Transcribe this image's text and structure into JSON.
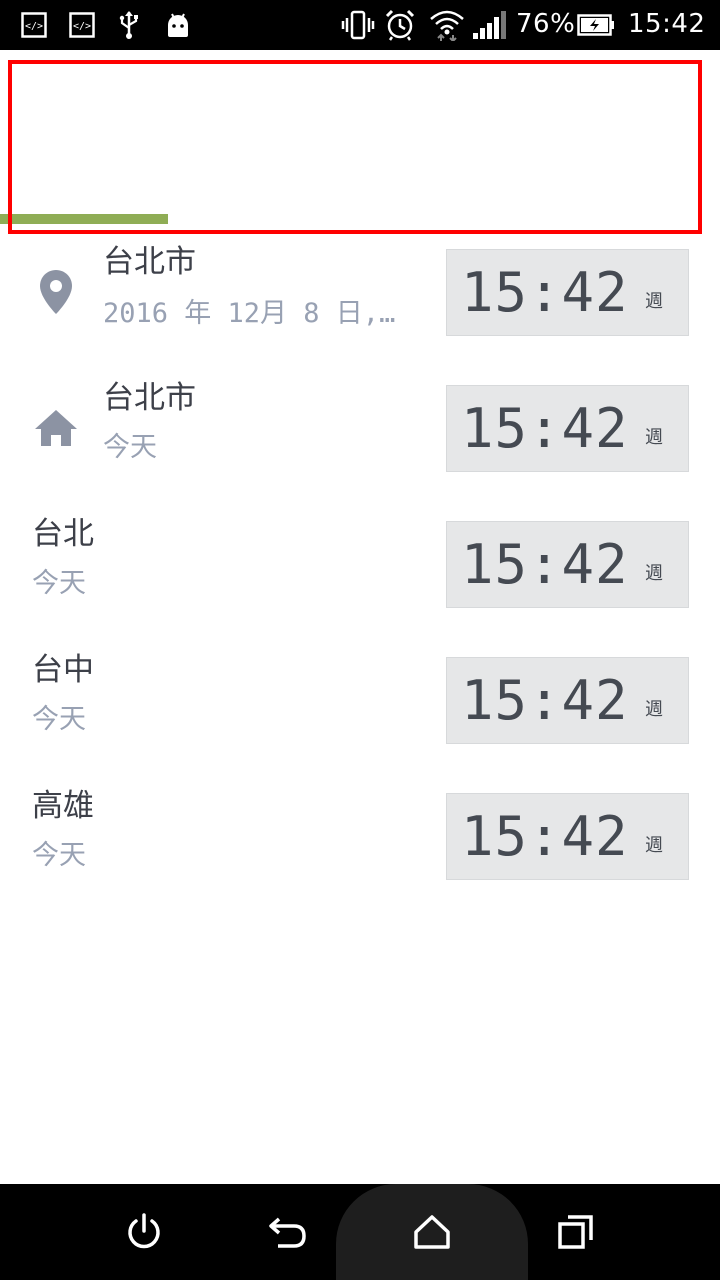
{
  "status_bar": {
    "battery_percent": "76%",
    "time": "15:42",
    "left_icons": [
      "code-icon",
      "code-icon",
      "usb-icon",
      "android-icon"
    ],
    "right_icons": [
      "vibrate-icon",
      "alarm-icon",
      "wifi-icon",
      "signal-icon",
      "battery-charging-icon"
    ]
  },
  "tabs": {
    "selected_index": 0
  },
  "colors": {
    "tab_indicator": "#8fad55",
    "highlight": "#ff0000",
    "city_text": "#3d4049",
    "sub_text": "#98a1b3",
    "clock_bg": "#e6e7e8"
  },
  "locations": [
    {
      "icon": "location-pin-icon",
      "city": "台北市",
      "date": "2016 年 12月 8 日,…",
      "time": "15:42",
      "day": "週"
    },
    {
      "icon": "home-icon",
      "city": "台北市",
      "date": "今天",
      "time": "15:42",
      "day": "週"
    },
    {
      "icon": "",
      "city": "台北",
      "date": "今天",
      "time": "15:42",
      "day": "週"
    },
    {
      "icon": "",
      "city": "台中",
      "date": "今天",
      "time": "15:42",
      "day": "週"
    },
    {
      "icon": "",
      "city": "高雄",
      "date": "今天",
      "time": "15:42",
      "day": "週"
    }
  ],
  "nav_bar": {
    "buttons": [
      "power-icon",
      "back-icon",
      "home-icon",
      "recents-icon"
    ]
  }
}
